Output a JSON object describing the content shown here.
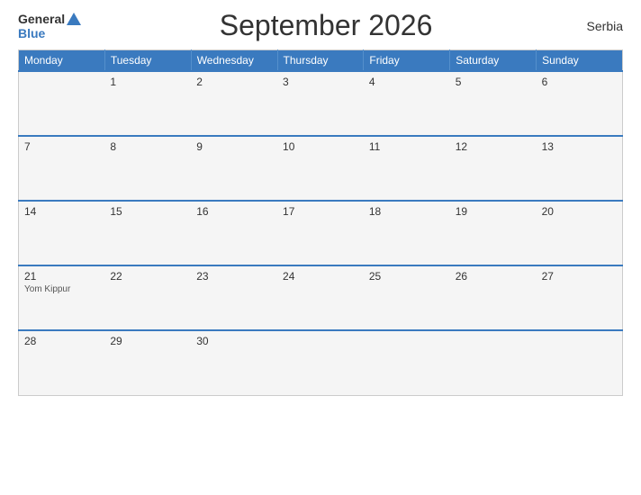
{
  "header": {
    "logo_general": "General",
    "logo_blue": "Blue",
    "title": "September 2026",
    "country": "Serbia"
  },
  "calendar": {
    "days_of_week": [
      "Monday",
      "Tuesday",
      "Wednesday",
      "Thursday",
      "Friday",
      "Saturday",
      "Sunday"
    ],
    "weeks": [
      [
        {
          "day": "",
          "event": ""
        },
        {
          "day": "1",
          "event": ""
        },
        {
          "day": "2",
          "event": ""
        },
        {
          "day": "3",
          "event": ""
        },
        {
          "day": "4",
          "event": ""
        },
        {
          "day": "5",
          "event": ""
        },
        {
          "day": "6",
          "event": ""
        }
      ],
      [
        {
          "day": "7",
          "event": ""
        },
        {
          "day": "8",
          "event": ""
        },
        {
          "day": "9",
          "event": ""
        },
        {
          "day": "10",
          "event": ""
        },
        {
          "day": "11",
          "event": ""
        },
        {
          "day": "12",
          "event": ""
        },
        {
          "day": "13",
          "event": ""
        }
      ],
      [
        {
          "day": "14",
          "event": ""
        },
        {
          "day": "15",
          "event": ""
        },
        {
          "day": "16",
          "event": ""
        },
        {
          "day": "17",
          "event": ""
        },
        {
          "day": "18",
          "event": ""
        },
        {
          "day": "19",
          "event": ""
        },
        {
          "day": "20",
          "event": ""
        }
      ],
      [
        {
          "day": "21",
          "event": "Yom Kippur"
        },
        {
          "day": "22",
          "event": ""
        },
        {
          "day": "23",
          "event": ""
        },
        {
          "day": "24",
          "event": ""
        },
        {
          "day": "25",
          "event": ""
        },
        {
          "day": "26",
          "event": ""
        },
        {
          "day": "27",
          "event": ""
        }
      ],
      [
        {
          "day": "28",
          "event": ""
        },
        {
          "day": "29",
          "event": ""
        },
        {
          "day": "30",
          "event": ""
        },
        {
          "day": "",
          "event": ""
        },
        {
          "day": "",
          "event": ""
        },
        {
          "day": "",
          "event": ""
        },
        {
          "day": "",
          "event": ""
        }
      ]
    ]
  }
}
